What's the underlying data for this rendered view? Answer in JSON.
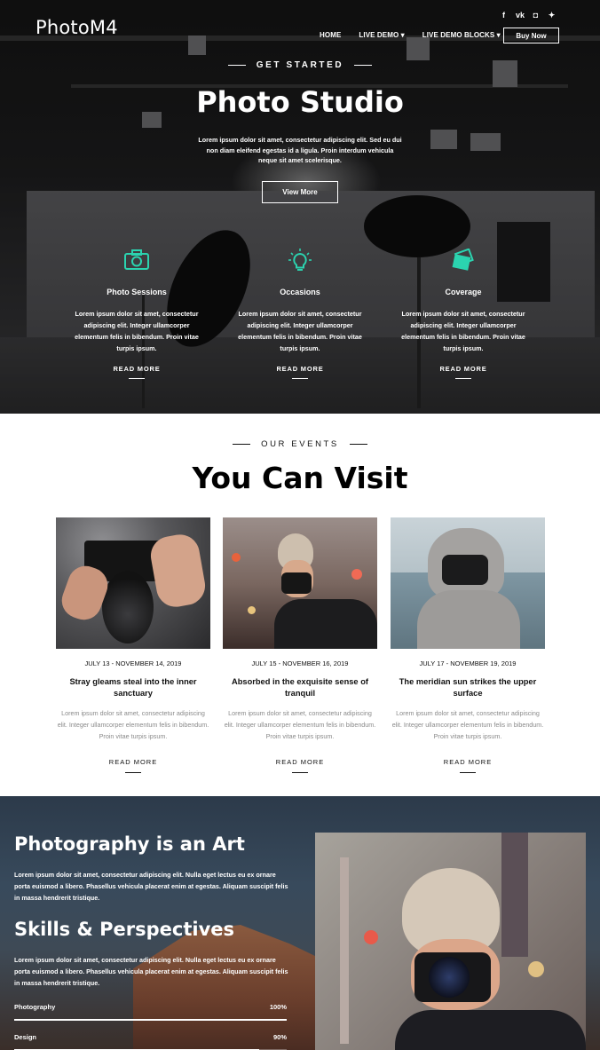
{
  "header": {
    "logo": "PhotoM4",
    "social_icons": [
      {
        "name": "facebook-icon",
        "glyph": "f"
      },
      {
        "name": "vk-icon",
        "glyph": "vk"
      },
      {
        "name": "instagram-icon",
        "glyph": "◘"
      },
      {
        "name": "twitter-icon",
        "glyph": "✦"
      }
    ],
    "nav": [
      "HOME",
      "LIVE DEMO ▾",
      "LIVE DEMO BLOCKS ▾"
    ],
    "buy_button": "Buy Now"
  },
  "hero": {
    "eyebrow": "GET STARTED",
    "title": "Photo Studio",
    "text": "Lorem ipsum dolor sit amet, consectetur adipiscing elit. Sed eu dui non diam eleifend egestas id a ligula. Proin interdum vehicula neque sit amet scelerisque.",
    "button": "View More",
    "accent_color": "#2bd4b0",
    "features": [
      {
        "icon": "camera-icon",
        "title": "Photo Sessions",
        "text": "Lorem ipsum dolor sit amet, consectetur adipiscing elit. Integer ullamcorper elementum felis in bibendum. Proin vitae turpis ipsum.",
        "link": "READ MORE"
      },
      {
        "icon": "lightbulb-icon",
        "title": "Occasions",
        "text": "Lorem ipsum dolor sit amet, consectetur adipiscing elit. Integer ullamcorper elementum felis in bibendum. Proin vitae turpis ipsum.",
        "link": "READ MORE"
      },
      {
        "icon": "photos-icon",
        "title": "Coverage",
        "text": "Lorem ipsum dolor sit amet, consectetur adipiscing elit. Integer ullamcorper elementum felis in bibendum. Proin vitae turpis ipsum.",
        "link": "READ MORE"
      }
    ]
  },
  "events": {
    "eyebrow": "OUR EVENTS",
    "title": "You Can Visit",
    "items": [
      {
        "date": "JULY 13 - NOVEMBER 14, 2019",
        "title": "Stray gleams steal into the inner sanctuary",
        "text": "Lorem ipsum dolor sit amet, consectetur adipiscing elit. Integer ullamcorper elementum felis in bibendum. Proin vitae turpis ipsum.",
        "link": "READ MORE"
      },
      {
        "date": "JULY 15 - NOVEMBER 16, 2019",
        "title": "Absorbed in the exquisite sense of tranquil",
        "text": "Lorem ipsum dolor sit amet, consectetur adipiscing elit. Integer ullamcorper elementum felis in bibendum. Proin vitae turpis ipsum.",
        "link": "READ MORE"
      },
      {
        "date": "JULY 17 - NOVEMBER 19, 2019",
        "title": "The meridian sun strikes the upper surface",
        "text": "Lorem ipsum dolor sit amet, consectetur adipiscing elit. Integer ullamcorper elementum felis in bibendum. Proin vitae turpis ipsum.",
        "link": "READ MORE"
      }
    ]
  },
  "art": {
    "title1": "Photography is an Art",
    "text1": "Lorem ipsum dolor sit amet, consectetur adipiscing elit. Nulla eget lectus eu ex ornare porta euismod a libero. Phasellus vehicula placerat enim at egestas. Aliquam suscipit felis in massa hendrerit tristique.",
    "title2": "Skills & Perspectives",
    "text2": "Lorem ipsum dolor sit amet, consectetur adipiscing elit. Nulla eget lectus eu ex ornare porta euismod a libero. Phasellus vehicula placerat enim at egestas. Aliquam suscipit felis in massa hendrerit tristique.",
    "skills": [
      {
        "label": "Photography",
        "value_text": "100%",
        "value": 1.0
      },
      {
        "label": "Design",
        "value_text": "90%",
        "value": 0.9
      }
    ]
  }
}
